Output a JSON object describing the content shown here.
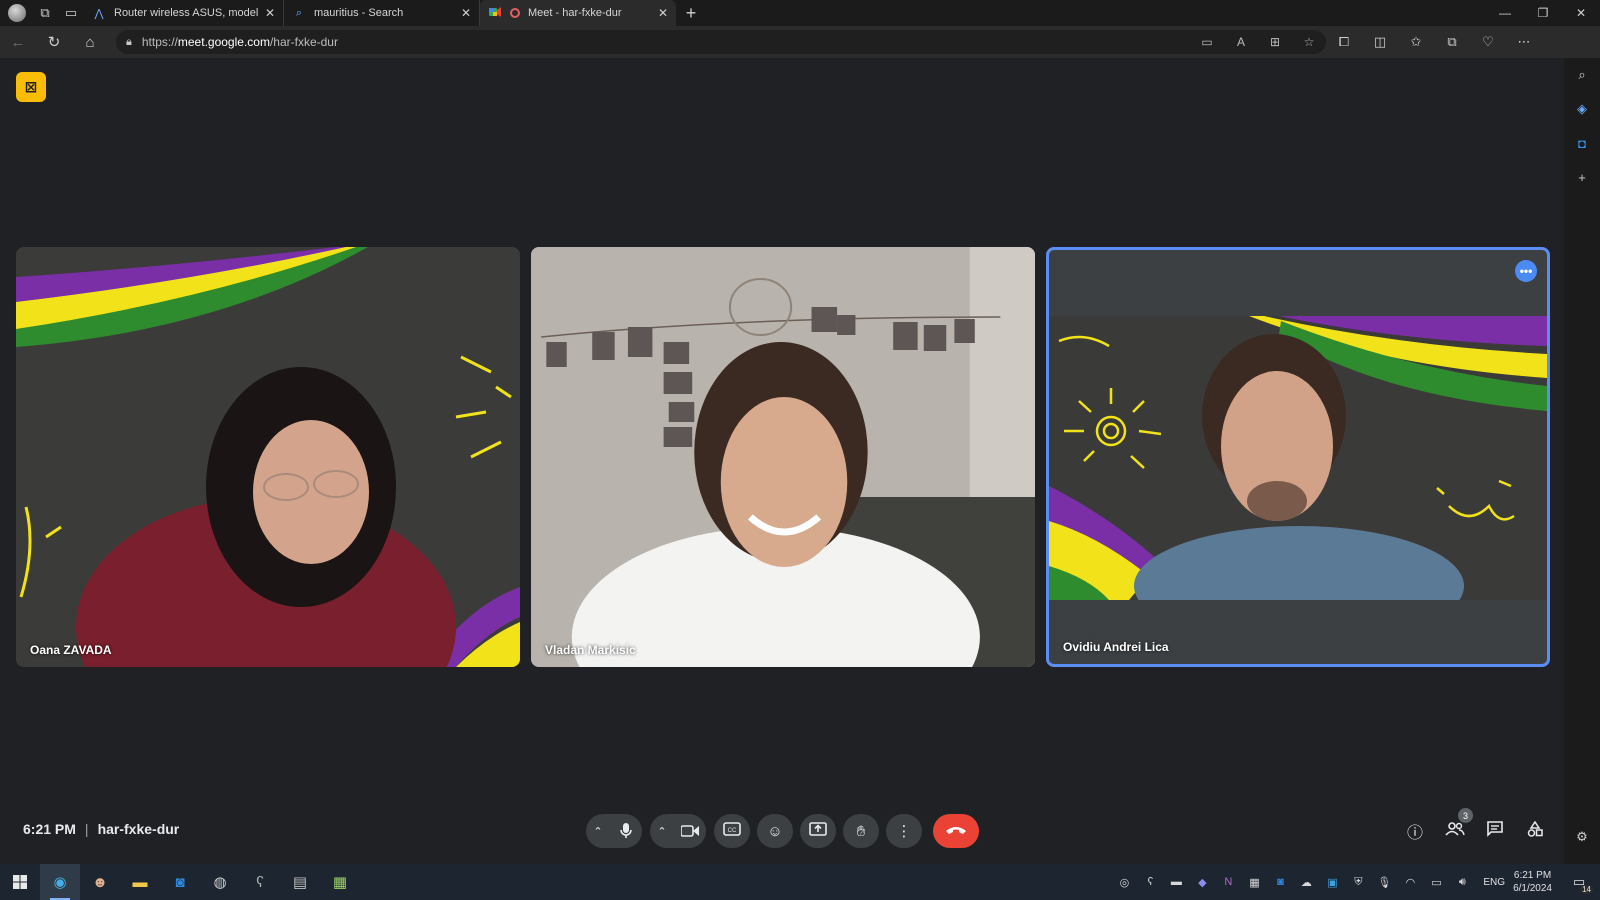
{
  "browser": {
    "tabs": [
      {
        "title": "Router wireless ASUS, model RT-",
        "favicon": "asus-icon",
        "active": false
      },
      {
        "title": "mauritius - Search",
        "favicon": "search-icon",
        "active": false
      },
      {
        "title": "Meet - har-fxke-dur",
        "favicon": "meet-icon",
        "active": true
      }
    ],
    "url_prefix": "https://",
    "url_host": "meet.google.com",
    "url_path": "/har-fxke-dur"
  },
  "meet": {
    "participants": [
      {
        "name": "Oana ZAVADA",
        "active_speaker": false
      },
      {
        "name": "Vladan Markisic",
        "active_speaker": false
      },
      {
        "name": "Ovidiu Andrei Lica",
        "active_speaker": true
      }
    ],
    "time": "6:21 PM",
    "separator": "|",
    "meeting_code": "har-fxke-dur",
    "participant_count": "3",
    "more_glyph": "•••"
  },
  "taskbar": {
    "language": "ENG",
    "clock_time": "6:21 PM",
    "clock_date": "6/1/2024",
    "notification_count": "14"
  },
  "colors": {
    "meet_background": "#202124",
    "control_button": "#3c4043",
    "hangup": "#ea4335",
    "active_speaker_border": "#5b8ef4",
    "notice_badge": "#fbbc04",
    "stripe_purple": "#7b2fa6",
    "stripe_yellow": "#f2e21a",
    "stripe_green": "#2e8b2e"
  }
}
